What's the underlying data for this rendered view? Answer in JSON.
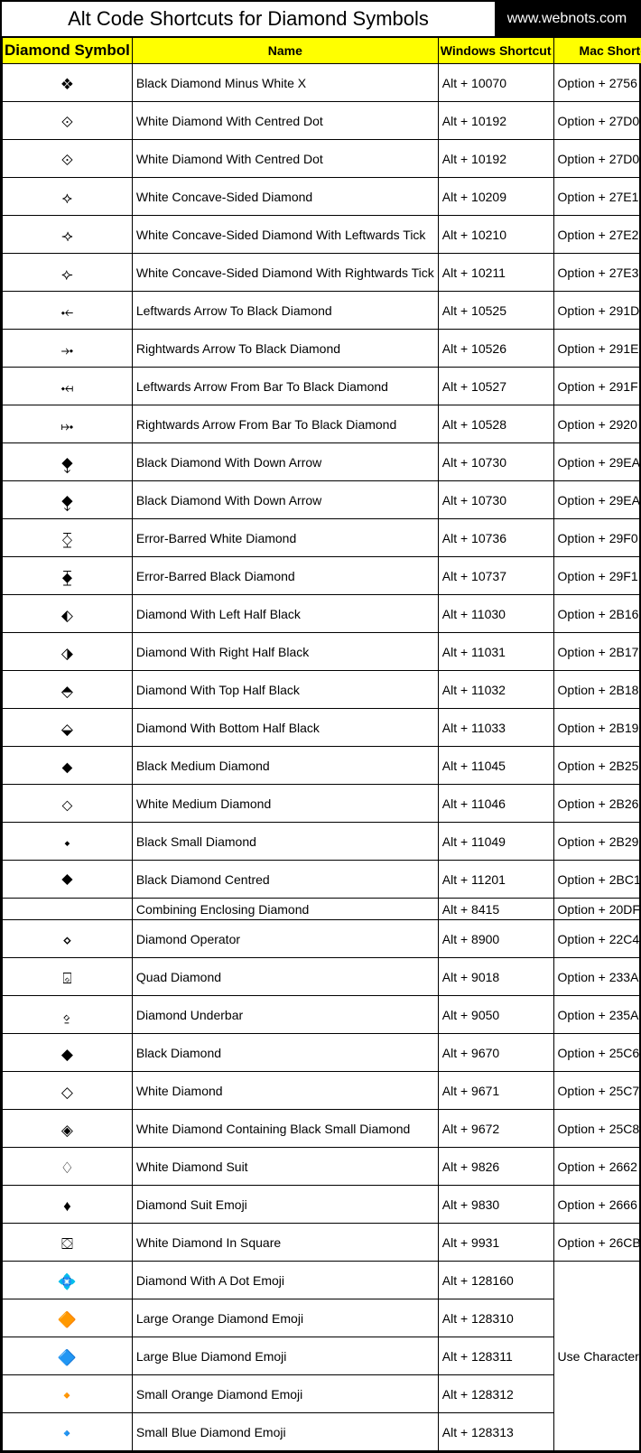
{
  "title": "Alt Code Shortcuts for Diamond Symbols",
  "site": "www.webnots.com",
  "headers": {
    "symbol": "Diamond Symbol",
    "name": "Name",
    "win": "Windows Shortcut",
    "mac": "Mac Shortcut"
  },
  "merged_mac_label": "Use Character Viewer",
  "rows": [
    {
      "sym": "❖",
      "name": "Black Diamond Minus White X",
      "win": "Alt + 10070",
      "mac": "Option + 2756"
    },
    {
      "sym": "⟐",
      "name": "White Diamond With Centred Dot",
      "win": "Alt + 10192",
      "mac": "Option + 27D0"
    },
    {
      "sym": "⟐",
      "name": "White Diamond With Centred Dot",
      "win": "Alt + 10192",
      "mac": "Option + 27D0"
    },
    {
      "sym": "⟡",
      "name": "White Concave-Sided Diamond",
      "win": "Alt + 10209",
      "mac": "Option + 27E1"
    },
    {
      "sym": "⟢",
      "name": "White Concave-Sided Diamond With Leftwards Tick",
      "win": "Alt + 10210",
      "mac": "Option + 27E2"
    },
    {
      "sym": "⟣",
      "name": "White Concave-Sided Diamond With Rightwards Tick",
      "win": "Alt + 10211",
      "mac": "Option + 27E3"
    },
    {
      "sym": "⤝",
      "name": "Leftwards Arrow To Black Diamond",
      "win": "Alt + 10525",
      "mac": "Option + 291D"
    },
    {
      "sym": "⤞",
      "name": "Rightwards Arrow To Black Diamond",
      "win": "Alt + 10526",
      "mac": "Option + 291E"
    },
    {
      "sym": "⤟",
      "name": "Leftwards Arrow From Bar To Black Diamond",
      "win": "Alt + 10527",
      "mac": "Option + 291F"
    },
    {
      "sym": "⤠",
      "name": "Rightwards Arrow From Bar To Black Diamond",
      "win": "Alt + 10528",
      "mac": "Option + 2920"
    },
    {
      "sym": "⧪",
      "name": "Black Diamond With Down Arrow",
      "win": "Alt + 10730",
      "mac": "Option + 29EA"
    },
    {
      "sym": "⧪",
      "name": "Black Diamond With Down Arrow",
      "win": "Alt + 10730",
      "mac": "Option + 29EA"
    },
    {
      "sym": "⧰",
      "name": "Error-Barred White Diamond",
      "win": "Alt + 10736",
      "mac": "Option + 29F0"
    },
    {
      "sym": "⧱",
      "name": "Error-Barred Black Diamond",
      "win": "Alt + 10737",
      "mac": "Option + 29F1"
    },
    {
      "sym": "⬖",
      "name": "Diamond With Left Half Black",
      "win": "Alt + 11030",
      "mac": "Option + 2B16"
    },
    {
      "sym": "⬗",
      "name": "Diamond With Right Half Black",
      "win": "Alt + 11031",
      "mac": "Option + 2B17"
    },
    {
      "sym": "⬘",
      "name": "Diamond With Top Half Black",
      "win": "Alt + 11032",
      "mac": "Option + 2B18"
    },
    {
      "sym": "⬙",
      "name": "Diamond With Bottom Half Black",
      "win": "Alt + 11033",
      "mac": "Option + 2B19"
    },
    {
      "sym": "⬥",
      "name": "Black Medium Diamond",
      "win": "Alt + 11045",
      "mac": "Option + 2B25"
    },
    {
      "sym": "⬦",
      "name": "White Medium Diamond",
      "win": "Alt + 11046",
      "mac": "Option + 2B26"
    },
    {
      "sym": "⬩",
      "name": "Black Small Diamond",
      "win": "Alt + 11049",
      "mac": "Option + 2B29"
    },
    {
      "sym": "⯁",
      "name": "Black Diamond Centred",
      "win": "Alt + 11201",
      "mac": "Option + 2BC1"
    },
    {
      "sym": "",
      "name": "Combining Enclosing Diamond",
      "win": "Alt + 8415",
      "mac": "Option + 20DF"
    },
    {
      "sym": "⋄",
      "name": "Diamond Operator",
      "win": "Alt + 8900",
      "mac": "Option + 22C4"
    },
    {
      "sym": "⌺",
      "name": "Quad Diamond",
      "win": "Alt + 9018",
      "mac": "Option + 233A"
    },
    {
      "sym": "⍚",
      "name": "Diamond Underbar",
      "win": "Alt + 9050",
      "mac": "Option + 235A"
    },
    {
      "sym": "◆",
      "name": "Black Diamond",
      "win": "Alt + 9670",
      "mac": "Option + 25C6"
    },
    {
      "sym": "◇",
      "name": "White Diamond",
      "win": "Alt + 9671",
      "mac": "Option + 25C7"
    },
    {
      "sym": "◈",
      "name": "White Diamond Containing Black Small Diamond",
      "win": "Alt + 9672",
      "mac": "Option + 25C8"
    },
    {
      "sym": "♢",
      "name": "White Diamond Suit",
      "win": "Alt + 9826",
      "mac": "Option + 2662"
    },
    {
      "sym": "♦",
      "name": "Diamond Suit Emoji",
      "win": "Alt + 9830",
      "mac": "Option + 2666"
    },
    {
      "sym": "⛋",
      "name": "White Diamond In Square",
      "win": "Alt + 9931",
      "mac": "Option + 26CB"
    },
    {
      "sym": "💠",
      "name": "Diamond With A Dot Emoji",
      "win": "Alt + 128160",
      "mac": "__MERGE_START__"
    },
    {
      "sym": "🔶",
      "name": "Large Orange Diamond Emoji",
      "win": "Alt + 128310",
      "mac": "__MERGE__"
    },
    {
      "sym": "🔷",
      "name": "Large Blue Diamond Emoji",
      "win": "Alt + 128311",
      "mac": "__MERGE__"
    },
    {
      "sym": "🔸",
      "name": "Small Orange Diamond Emoji",
      "win": "Alt + 128312",
      "mac": "__MERGE__"
    },
    {
      "sym": "🔹",
      "name": "Small Blue Diamond Emoji",
      "win": "Alt + 128313",
      "mac": "__MERGE__"
    }
  ]
}
